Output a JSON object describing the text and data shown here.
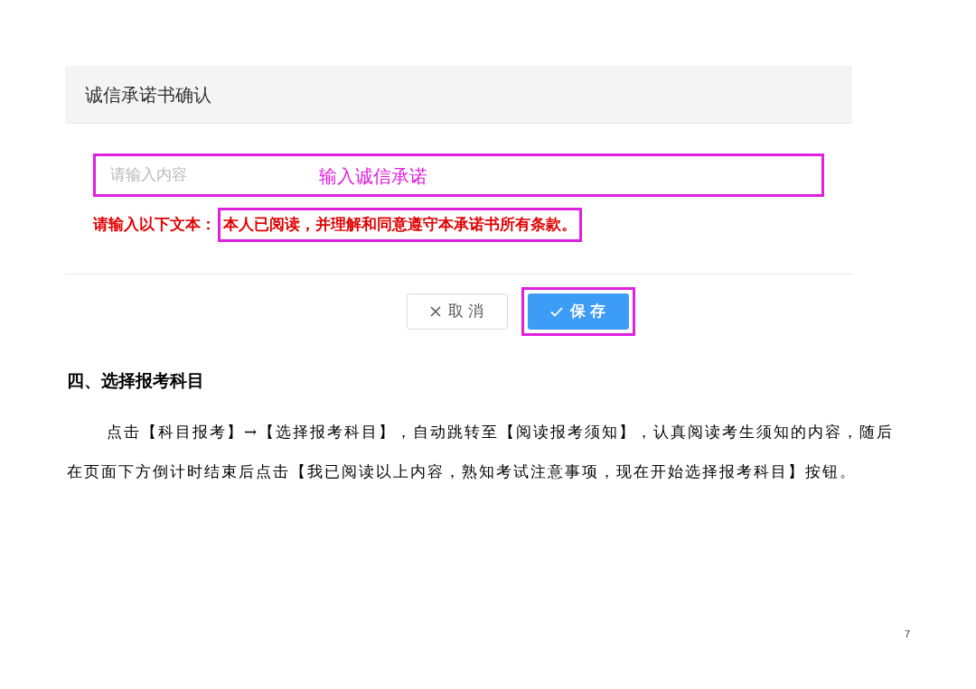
{
  "dialog": {
    "title": "诚信承诺书确认",
    "input": {
      "placeholder": "请输入内容"
    },
    "annotation": "输入诚信承诺",
    "hint": {
      "label": "请输入以下文本：",
      "text": "本人已阅读，并理解和同意遵守本承诺书所有条款。"
    },
    "buttons": [
      {
        "kind": "cancel",
        "label": "取 消",
        "highlighted": false
      },
      {
        "kind": "save",
        "label": "保 存",
        "highlighted": true
      }
    ]
  },
  "section": {
    "heading": "四、选择报考科目",
    "paragraph": "点击【科目报考】→【选择报考科目】，自动跳转至【阅读报考须知】，认真阅读考生须知的内容，随后在页面下方倒计时结束后点击【我已阅读以上内容，熟知考试注意事项，现在开始选择报考科目】按钮。"
  },
  "page_number": "7"
}
